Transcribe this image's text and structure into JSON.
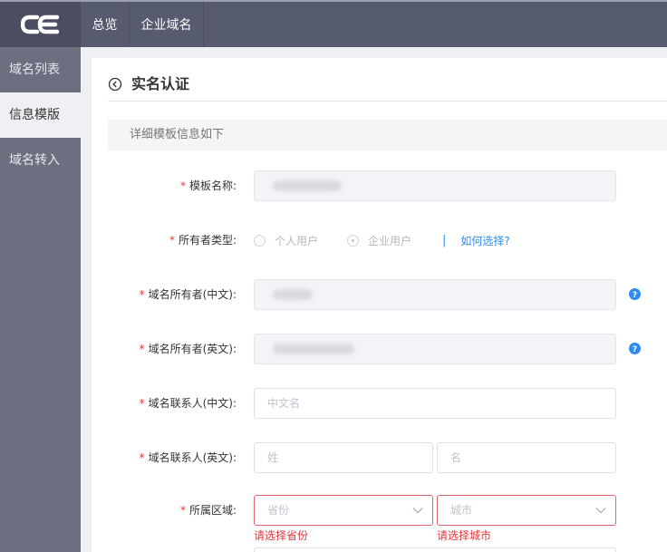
{
  "brand": {
    "logo_text": "CE",
    "accent": "#2d8cf0",
    "error": "#e4393c"
  },
  "topnav": {
    "items": [
      {
        "label": "总览"
      },
      {
        "label": "企业域名"
      }
    ]
  },
  "sidebar": {
    "items": [
      {
        "label": "域名列表",
        "active": false
      },
      {
        "label": "信息模版",
        "active": true
      },
      {
        "label": "域名转入",
        "active": false
      }
    ]
  },
  "page": {
    "title": "实名认证",
    "section": "详细模板信息如下"
  },
  "form": {
    "template_name": {
      "label": "模板名称:",
      "value": ""
    },
    "owner_type": {
      "label": "所有者类型:",
      "options": [
        {
          "label": "个人用户",
          "checked": false
        },
        {
          "label": "企业用户",
          "checked": true
        }
      ],
      "separator": "|",
      "help_link": "如何选择?"
    },
    "owner_cn": {
      "label": "域名所有者(中文):",
      "value": ""
    },
    "owner_en": {
      "label": "域名所有者(英文):",
      "value": ""
    },
    "contact_cn": {
      "label": "域名联系人(中文):",
      "placeholder": "中文名"
    },
    "contact_en": {
      "label": "域名联系人(英文):",
      "surname_placeholder": "姓",
      "given_placeholder": "名"
    },
    "region": {
      "label": "所属区域:",
      "province_placeholder": "省份",
      "city_placeholder": "城市",
      "province_error": "请选择省份",
      "city_error": "请选择城市"
    }
  }
}
